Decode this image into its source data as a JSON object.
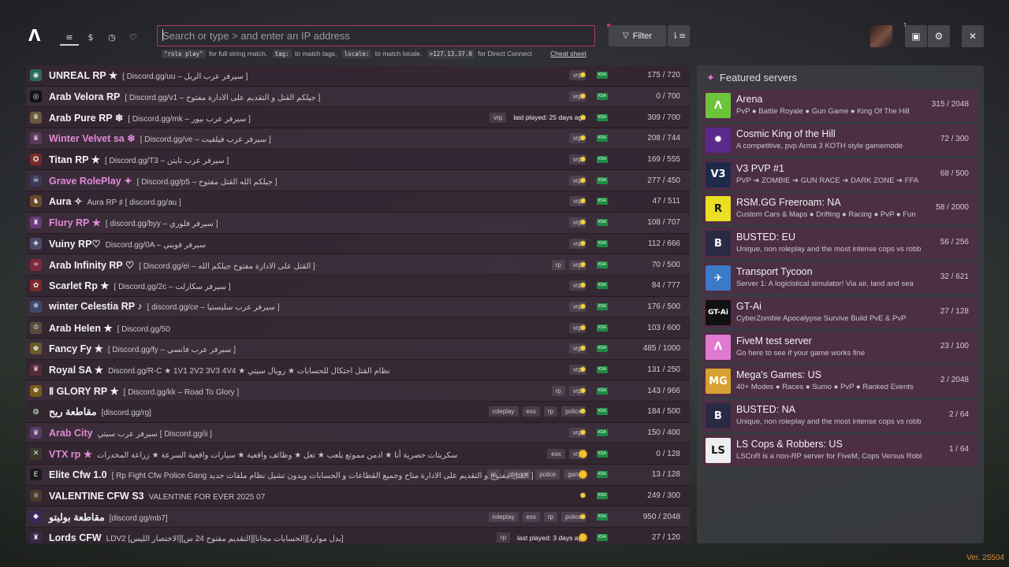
{
  "nav": {
    "logo": "Λ",
    "items": [
      {
        "icon": "list-icon"
      },
      {
        "icon": "dollar-icon",
        "glyph": "$"
      },
      {
        "icon": "history-icon"
      },
      {
        "icon": "heart-icon"
      }
    ]
  },
  "search": {
    "placeholder": "Search or type > and enter an IP address"
  },
  "hints": {
    "code1": "\"role play\"",
    "text1": "for full string match,",
    "code2": "tag:",
    "text2": "to match tags,",
    "code3": "locale:",
    "text3": "to match locale,",
    "code4": ">127.13.37.0",
    "text4": "for Direct Connect",
    "cheat": "Cheat sheet"
  },
  "toolbar": {
    "filter_label": "Filter",
    "notification_count": "1"
  },
  "servers": [
    {
      "name": "UNREAL RP ★",
      "desc": "[ Discord.gg/uu – سيرفر عرب الريل ]",
      "tags": [
        "vrp"
      ],
      "last": "",
      "pink": false,
      "icon_color": "#2a6a5a",
      "icon": "◉",
      "ping": "sun",
      "players": "175 / 720"
    },
    {
      "name": "Arab Velora RP",
      "desc": "[ Discord.gg/v1 – جيلكم القتل و التقديم على الادارة مفتوح ]",
      "tags": [
        "vrp"
      ],
      "last": "",
      "pink": false,
      "icon_color": "#111111",
      "icon": "◎",
      "ping": "sun",
      "players": "0 / 700"
    },
    {
      "name": "Arab Pure RP ❄",
      "desc": "[ Discord.gg/mk – سيرفر عرب بيور ]",
      "tags": [
        "vrp"
      ],
      "last": "last played: 25 days ago",
      "pink": false,
      "icon_color": "#6a5a3a",
      "icon": "♛",
      "ping": "sun",
      "players": "309 / 700"
    },
    {
      "name": "Winter Velvet sa ❄",
      "desc": "[ Discord.gg/ve – سيرفر عرب فيلفيت ]",
      "tags": [
        "vrp"
      ],
      "last": "",
      "pink": true,
      "icon_color": "#5a3a5a",
      "icon": "♛",
      "ping": "sun",
      "players": "208 / 744"
    },
    {
      "name": "Titan RP ★",
      "desc": "[ Discord.gg/T3 – سيرفر عرب تايتن ]",
      "tags": [
        "vrp"
      ],
      "last": "",
      "pink": false,
      "icon_color": "#7a2a2a",
      "icon": "✪",
      "ping": "sun",
      "players": "169 / 555"
    },
    {
      "name": "Grave RolePlay ✦",
      "desc": "[ Discord.gg/p5 – جيلكم الله القتل مفتوح ]",
      "tags": [
        "vrp"
      ],
      "last": "",
      "pink": true,
      "icon_color": "#3a3a5a",
      "icon": "☠",
      "ping": "sun",
      "players": "277 / 450"
    },
    {
      "name": "Aura ✧",
      "desc": "Aura RP ♯ [ discord.gg/au ]",
      "tags": [
        "vrp"
      ],
      "last": "",
      "pink": false,
      "icon_color": "#6a4a2a",
      "icon": "♞",
      "ping": "sun",
      "players": "47 / 511"
    },
    {
      "name": "Flury RP ★",
      "desc": "[ discord.gg/byy – سيرفر فلوري ]",
      "tags": [
        "vrp"
      ],
      "last": "",
      "pink": true,
      "icon_color": "#6a3a7a",
      "icon": "♜",
      "ping": "sun",
      "players": "108 / 707"
    },
    {
      "name": "Vuiny RP♡",
      "desc": "Discord.gg/0A – سيرفر فويني",
      "tags": [
        "vrp"
      ],
      "last": "",
      "pink": false,
      "icon_color": "#4a4a6a",
      "icon": "◈",
      "ping": "sun",
      "players": "112 / 666"
    },
    {
      "name": "Arab Infinity RP ♡",
      "desc": "[ Discord.gg/ei – القتل على الادارة مفتوح جيلكم الله ]",
      "tags": [
        "rp",
        "vrp"
      ],
      "last": "",
      "pink": false,
      "icon_color": "#7a2a3a",
      "icon": "∞",
      "ping": "sun",
      "players": "70 / 500"
    },
    {
      "name": "Scarlet Rp ★",
      "desc": "[ Discord.gg/2c – سيرفر سكارلت ]",
      "tags": [
        "vrp"
      ],
      "last": "",
      "pink": false,
      "icon_color": "#7a2a2a",
      "icon": "✿",
      "ping": "sun",
      "players": "84 / 777"
    },
    {
      "name": "winter Celestia RP ♪",
      "desc": "[ discord.gg/ce – سيرفر عرب سليستيا ]",
      "tags": [
        "vrp"
      ],
      "last": "",
      "pink": false,
      "icon_color": "#3a4a6a",
      "icon": "❄",
      "ping": "sun",
      "players": "176 / 500"
    },
    {
      "name": "Arab Helen ★",
      "desc": "[ Discord.gg/50",
      "tags": [
        "vrp"
      ],
      "last": "",
      "pink": false,
      "icon_color": "#5a4a3a",
      "icon": "♔",
      "ping": "sun",
      "players": "103 / 600"
    },
    {
      "name": "Fancy Fy ★",
      "desc": "[ Discord.gg/fy – سيرفر عرب فانسي ]",
      "tags": [
        "vrp"
      ],
      "last": "",
      "pink": false,
      "icon_color": "#6a5a2a",
      "icon": "♚",
      "ping": "sun",
      "players": "485 / 1000"
    },
    {
      "name": "Royal SA ★",
      "desc": "Discord.gg/R-C ★ 1V1 2V2 3V3 4V4 ★ نظام القتل احتكال للحسابات ★ رويال سيتي",
      "tags": [
        "vrp"
      ],
      "last": "",
      "pink": false,
      "icon_color": "#5a2a3a",
      "icon": "♛",
      "ping": "sun",
      "players": "131 / 250"
    },
    {
      "name": "Ⅱ GLORY RP ★",
      "desc": "[ Discord.gg/kk – Road To Glory ]",
      "tags": [
        "rp",
        "vrp"
      ],
      "last": "",
      "pink": false,
      "icon_color": "#7a5a1a",
      "icon": "♚",
      "ping": "sun",
      "players": "143 / 966"
    },
    {
      "name": "مقاطعة ريح",
      "desc": "[discord.gg/rg]",
      "tags": [
        "roleplay",
        "esx",
        "rp",
        "police"
      ],
      "last": "",
      "pink": false,
      "icon_color": "#2a2a2a",
      "icon": "◍",
      "ping": "sun",
      "players": "184 / 500"
    },
    {
      "name": "Arab City",
      "desc": "سيرفر عرب سيتي [ Discord.gg/ii ]",
      "tags": [
        "vrp"
      ],
      "last": "",
      "pink": true,
      "icon_color": "#5a3a6a",
      "icon": "♛",
      "ping": "sun",
      "players": "150 / 400"
    },
    {
      "name": "VTX rp ★",
      "desc": "سكربتات حصرية أنا ★ ادمن مموتع يلعب ★ تعل ★ وظائف واقعية ★ سيارات واقعية السرعة ★ زراعة المخدرات",
      "tags": [
        "esx",
        "vrp"
      ],
      "last": "",
      "pink": true,
      "icon_color": "#3a3a2a",
      "icon": "✕",
      "ping": "ring",
      "players": "0 / 128"
    },
    {
      "name": "Elite Cfw 1.0",
      "desc": "[ Rp Fight Cfw Police Gang القتل مفتوح و التقديم على الادارة متاح وجميع القطاعات و الحسابات ويدون تشيل نظام ملفات جديد ]",
      "tags": [
        "rp",
        "qbcore",
        "police",
        "gang"
      ],
      "last": "",
      "pink": false,
      "icon_color": "#1a1a1a",
      "icon": "E",
      "ping": "ring",
      "players": "13 / 128"
    },
    {
      "name": "VALENTINE CFW S3",
      "desc": "VALENTINE FOR EVER 2025 07",
      "tags": [],
      "last": "",
      "pink": false,
      "icon_color": "#4a3a2a",
      "icon": "♕",
      "ping": "sun",
      "players": "249 / 300"
    },
    {
      "name": "مقاطعة بوليتو",
      "desc": "[discord.gg/mb7]",
      "tags": [
        "roleplay",
        "esx",
        "rp",
        "police"
      ],
      "last": "",
      "pink": false,
      "icon_color": "#3a2a5a",
      "icon": "◆",
      "ping": "sun",
      "players": "950 / 2048"
    },
    {
      "name": "Lords CFW",
      "desc": "LDV2 [الاختصار الليس][التقديم مفتوح 24 س][الحسابات مجانا][بدل موارد]",
      "tags": [
        "rp"
      ],
      "last": "last played: 3 days ago",
      "pink": false,
      "icon_color": "#3a2a4a",
      "icon": "♜",
      "ping": "ring",
      "players": "27 / 120"
    }
  ],
  "flag_label": "KSA",
  "featured": {
    "title": "Featured servers",
    "items": [
      {
        "name": "Arena",
        "desc": "PvP ● Battle Royale ● Gun Game ● King Of The Hill",
        "players": "315 / 2048",
        "img_color": "#6cc43a",
        "img_text": "Λ"
      },
      {
        "name": "Cosmic King of the Hill",
        "desc": "A competitive, pvp Arma 3 KOTH style gamemode",
        "players": "72 / 300",
        "img_color": "#5a2a8a",
        "img_text": "✹"
      },
      {
        "name": "V3 PVP #1",
        "desc": "PVP ➔ ZOMBIE ➔ GUN RACE ➔ DARK ZONE ➔ FFA",
        "players": "68 / 500",
        "img_color": "#1e2a4a",
        "img_text": "V3"
      },
      {
        "name": "RSM.GG Freeroam: NA",
        "desc": "Custom Cars & Maps ● Drifting ● Racing ● PvP ● Fun",
        "players": "58 / 2000",
        "img_color": "#e8e020",
        "img_text": "R"
      },
      {
        "name": "BUSTED: EU",
        "desc": "Unique, non roleplay and the most intense cops vs robbers",
        "players": "56 / 256",
        "img_color": "#2a2a44",
        "img_text": "B"
      },
      {
        "name": "Transport Tycoon",
        "desc": "Server 1: A logicistical simulator! Via air, land and sea",
        "players": "32 / 621",
        "img_color": "#3a7ac8",
        "img_text": "✈"
      },
      {
        "name": "GT-Ai",
        "desc": "CyberZombie Apocalypse Survive Build PvE & PvP",
        "players": "27 / 128",
        "img_color": "#111111",
        "img_text": "GT-Ai"
      },
      {
        "name": "FiveM test server",
        "desc": "Go here to see if your game works fine",
        "players": "23 / 100",
        "img_color": "#e07ad0",
        "img_text": "Λ"
      },
      {
        "name": "Mega's Games: US",
        "desc": "40+ Modes ● Races ● Sumo ● PvP ● Ranked Events",
        "players": "2 / 2048",
        "img_color": "#d8a030",
        "img_text": "MG"
      },
      {
        "name": "BUSTED: NA",
        "desc": "Unique, non roleplay and the most intense cops vs robbers",
        "players": "2 / 64",
        "img_color": "#2a2a44",
        "img_text": "B"
      },
      {
        "name": "LS Cops & Robbers: US",
        "desc": "LSCnR is a non-RP server for FiveM, Cops Versus Robbers",
        "players": "1 / 64",
        "img_color": "#eeeeee",
        "img_text": "LS"
      }
    ]
  },
  "version": "Ver. 25504"
}
